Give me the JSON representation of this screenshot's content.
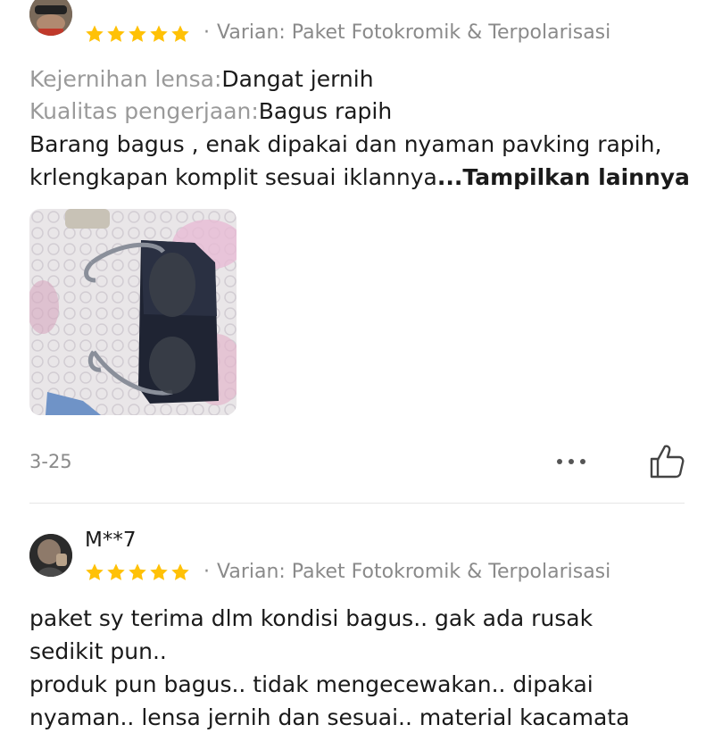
{
  "reviews": [
    {
      "variant": "Varian: Paket Fotokromik & Terpolarisasi",
      "rating": 5,
      "attributes": [
        {
          "label": "Kejernihan lensa:",
          "value": "Dangat jernih"
        },
        {
          "label": "Kualitas pengerjaan:",
          "value": "Bagus rapih"
        }
      ],
      "body_lines": [
        "Barang bagus , enak dipakai dan nyaman pavking rapih,",
        "krlengkapan komplit sesuai iklannya"
      ],
      "ellipsis": "...",
      "more_label": "Tampilkan lainnya",
      "date": "3-25",
      "more_icon": "more-horizontal-icon",
      "like_icon": "thumbs-up-icon"
    },
    {
      "username": "M**7",
      "variant": "Varian: Paket Fotokromik & Terpolarisasi",
      "rating": 5,
      "body_lines": [
        "paket sy terima dlm kondisi bagus.. gak ada rusak",
        "sedikit pun..",
        "produk pun bagus.. tidak mengecewakan.. dipakai",
        "nyaman.. lensa jernih dan sesuai.. material kacamata"
      ]
    }
  ],
  "colors": {
    "star": "#FFC107",
    "muted_text": "#8a8a8a",
    "label_text": "#9a9a9a"
  }
}
